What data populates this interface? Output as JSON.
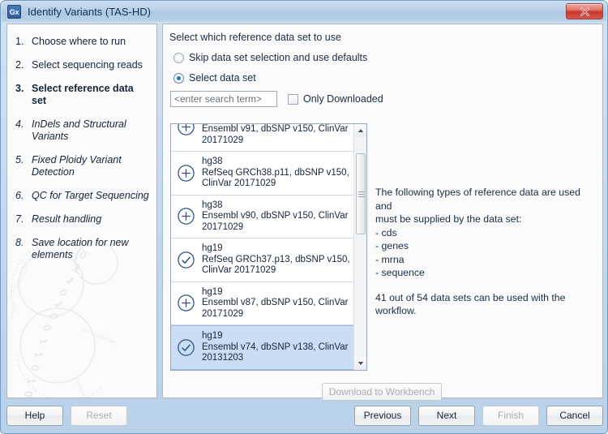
{
  "window": {
    "icon_label": "Gx",
    "title": "Identify Variants (TAS-HD)",
    "close_label": "Close"
  },
  "sidebar": {
    "steps": [
      {
        "num": "1.",
        "label": "Choose where to run",
        "state": "done"
      },
      {
        "num": "2.",
        "label": "Select sequencing reads",
        "state": "done"
      },
      {
        "num": "3.",
        "label": "Select reference data set",
        "state": "current"
      },
      {
        "num": "4.",
        "label": "InDels and Structural Variants",
        "state": "future"
      },
      {
        "num": "5.",
        "label": "Fixed Ploidy Variant Detection",
        "state": "future"
      },
      {
        "num": "6.",
        "label": "QC for Target Sequencing",
        "state": "future"
      },
      {
        "num": "7.",
        "label": "Result handling",
        "state": "future"
      },
      {
        "num": "8.",
        "label": "Save location for new elements",
        "state": "future"
      }
    ]
  },
  "main": {
    "heading": "Select which reference data set to use",
    "radio_skip": {
      "label": "Skip data set selection and use defaults",
      "selected": false
    },
    "radio_select": {
      "label": "Select data set",
      "selected": true
    },
    "search": {
      "value": "<enter search term>",
      "placeholder": "<enter search term>"
    },
    "only_downloaded": {
      "label": "Only Downloaded",
      "checked": false
    },
    "datasets": [
      {
        "title": "",
        "desc": "Ensembl v91, dbSNP v150, ClinVar 20171029",
        "icon": "plus-circle-icon",
        "downloaded": false,
        "selected": false
      },
      {
        "title": "hg38",
        "desc": "RefSeq GRCh38.p11, dbSNP v150, ClinVar 20171029",
        "icon": "plus-circle-icon",
        "downloaded": false,
        "selected": false
      },
      {
        "title": "hg38",
        "desc": "Ensembl v90, dbSNP v150, ClinVar 20171029",
        "icon": "plus-circle-icon",
        "downloaded": false,
        "selected": false
      },
      {
        "title": "hg19",
        "desc": "RefSeq GRCh37.p13, dbSNP v150, ClinVar 20171029",
        "icon": "check-circle-icon",
        "downloaded": true,
        "selected": false
      },
      {
        "title": "hg19",
        "desc": "Ensembl v87, dbSNP v150, ClinVar 20171029",
        "icon": "plus-circle-icon",
        "downloaded": false,
        "selected": false
      },
      {
        "title": "hg19",
        "desc": "Ensembl v74, dbSNP v138, ClinVar 20131203",
        "icon": "check-circle-icon",
        "downloaded": true,
        "selected": true
      }
    ],
    "info": {
      "line1": "The following types of reference data are used and",
      "line2": "must be supplied by the data set:",
      "line3": "- cds",
      "line4": "- genes",
      "line5": "- mrna",
      "line6": "- sequence",
      "line7": "41 out of 54 data sets can be used with the",
      "line8": "workflow."
    },
    "download_button": {
      "label": "Download to Workbench",
      "enabled": false
    }
  },
  "footer": {
    "help": {
      "label": "Help",
      "enabled": true
    },
    "reset": {
      "label": "Reset",
      "enabled": false
    },
    "previous": {
      "label": "Previous",
      "enabled": true
    },
    "next": {
      "label": "Next",
      "enabled": true
    },
    "finish": {
      "label": "Finish",
      "enabled": false
    },
    "cancel": {
      "label": "Cancel",
      "enabled": true
    }
  },
  "colors": {
    "titlebar": "#b6cee6",
    "selection": "#cbddf4",
    "accent": "#1f72c8",
    "icon_stroke": "#2b4f86",
    "close_red": "#c9372e"
  }
}
